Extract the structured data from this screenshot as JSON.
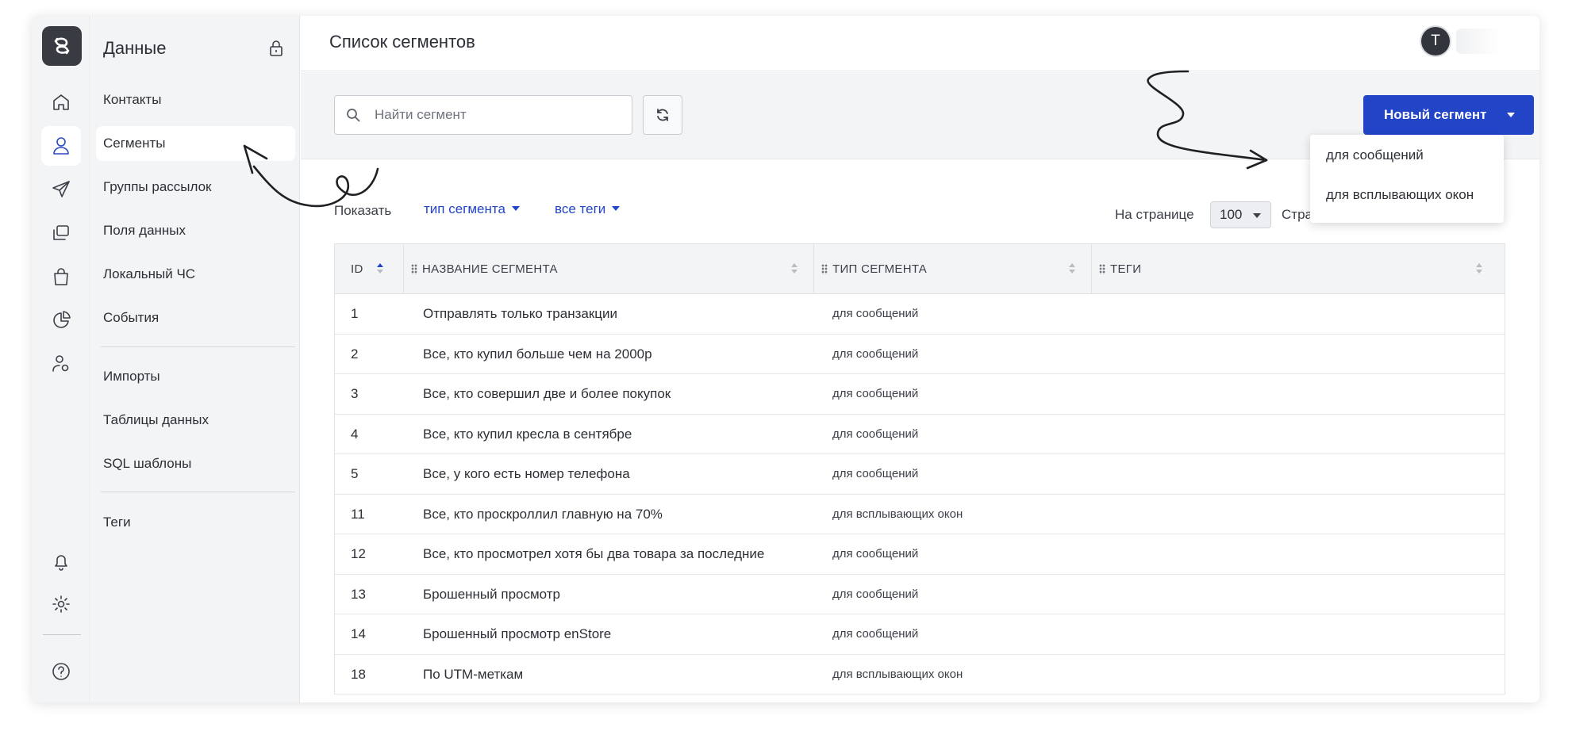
{
  "header": {
    "page_title": "Список сегментов",
    "avatar_initial": "T"
  },
  "nav": {
    "title": "Данные",
    "items": [
      {
        "label": "Контакты"
      },
      {
        "label": "Сегменты"
      },
      {
        "label": "Группы рассылок"
      },
      {
        "label": "Поля данных"
      },
      {
        "label": "Локальный ЧС"
      },
      {
        "label": "События"
      },
      {
        "label": "Импорты"
      },
      {
        "label": "Таблицы данных"
      },
      {
        "label": "SQL шаблоны"
      },
      {
        "label": "Теги"
      }
    ],
    "active_item": "Сегменты"
  },
  "rail": {
    "icons": [
      "home-icon",
      "user-icon",
      "send-icon",
      "copy-icon",
      "bag-icon",
      "pie-chart-icon",
      "user-settings-icon",
      "bell-icon",
      "gear-icon",
      "help-icon"
    ],
    "active_icon": "user-icon"
  },
  "toolbar": {
    "search_placeholder": "Найти сегмент",
    "new_segment_label": "Новый сегмент",
    "new_segment_menu": [
      "для сообщений",
      "для всплывающих окон"
    ]
  },
  "filters": {
    "show_label": "Показать",
    "segment_type_filter": "тип сегмента",
    "tags_filter": "все теги",
    "per_page_label": "На странице",
    "per_page_value": "100",
    "page_label": "Стра"
  },
  "table": {
    "columns": [
      "ID",
      "НАЗВАНИЕ СЕГМЕНТА",
      "ТИП СЕГМЕНТА",
      "ТЕГИ"
    ],
    "sorted_column": "ID",
    "rows": [
      {
        "id": "1",
        "name": "Отправлять только транзакции",
        "type": "для сообщений",
        "tags": ""
      },
      {
        "id": "2",
        "name": "Все, кто купил больше чем на 2000р",
        "type": "для сообщений",
        "tags": ""
      },
      {
        "id": "3",
        "name": "Все, кто совершил две и более покупок",
        "type": "для сообщений",
        "tags": ""
      },
      {
        "id": "4",
        "name": "Все, кто купил кресла в сентябре",
        "type": "для сообщений",
        "tags": ""
      },
      {
        "id": "5",
        "name": "Все, у кого есть номер телефона",
        "type": "для сообщений",
        "tags": ""
      },
      {
        "id": "11",
        "name": "Все, кто проскроллил главную на 70%",
        "type": "для всплывающих окон",
        "tags": ""
      },
      {
        "id": "12",
        "name": "Все, кто просмотрел хотя бы два товара за последние",
        "type": "для сообщений",
        "tags": ""
      },
      {
        "id": "13",
        "name": "Брошенный просмотр",
        "type": "для сообщений",
        "tags": ""
      },
      {
        "id": "14",
        "name": "Брошенный просмотр enStore",
        "type": "для сообщений",
        "tags": ""
      },
      {
        "id": "18",
        "name": "По UTM-меткам",
        "type": "для всплывающих окон",
        "tags": ""
      }
    ]
  },
  "colors": {
    "accent": "#2245c8",
    "sidebar_bg": "#f3f4f6",
    "logo_bg": "#383b42"
  }
}
